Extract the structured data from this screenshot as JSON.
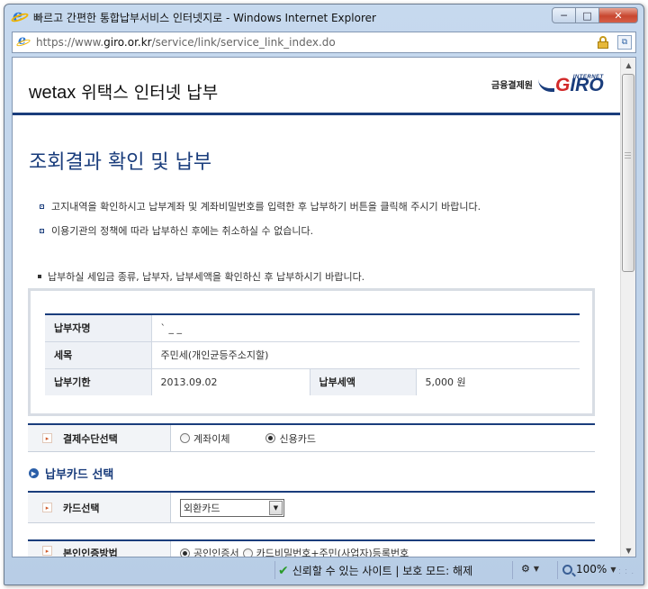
{
  "window": {
    "title": "빠르고 간편한 통합납부서비스 인터넷지로 - Windows Internet Explorer",
    "url_prefix": "https://www.",
    "url_host": "giro.or.kr",
    "url_path": "/service/link/service_link_index.do",
    "minimize": "─",
    "maximize": "□",
    "close": "✕"
  },
  "header": {
    "brand": "wetax",
    "title": " 위택스 인터넷 납부",
    "logo_label": "금융결제원",
    "logo_word_g": "G",
    "logo_word_rest": "IRO",
    "logo_internet": "INTERNET"
  },
  "page": {
    "title": "조회결과 확인 및 납부",
    "notices": [
      "고지내역을 확인하시고 납부계좌 및 계좌비밀번호를 입력한 후 납부하기 버튼을 클릭해 주시기 바랍니다.",
      "이용기관의 정책에 따라 납부하신 후에는 취소하실 수 없습니다."
    ],
    "confirm_note": "납부하실 세입금 종류, 납부자, 납부세액을 확인하신 후 납부하시기 바랍니다."
  },
  "info": {
    "payer_label": "납부자명",
    "payer_value": "`  _ _",
    "tax_label": "세목",
    "tax_value": "주민세(개인균등주소지할)",
    "due_label": "납부기한",
    "due_value": "2013.09.02",
    "amount_label": "납부세액",
    "amount_value": "5,000 원"
  },
  "payment_method": {
    "label": "결제수단선택",
    "option_transfer": "계좌이체",
    "option_card": "신용카드",
    "selected": "card"
  },
  "card_section": {
    "heading": "납부카드 선택",
    "card_label": "카드선택",
    "card_value": "외환카드"
  },
  "auth": {
    "label": "본인인증방법",
    "option_cert": "공인인증서",
    "option_pw": "카드비밀번호+주민(사업자)등록번호"
  },
  "statusbar": {
    "trusted": "신뢰할 수 있는 사이트 | 보호 모드: 해제",
    "zoom": "100%"
  },
  "icons": {
    "check": "✔",
    "arrow_right": "▸",
    "circle_arrow": "▶",
    "triangle_down": "▼",
    "triangle_up": "▲"
  },
  "colors": {
    "accent_navy": "#1a3d7c",
    "brand_red": "#d22a2a",
    "trusted_green": "#2a9a2a"
  }
}
